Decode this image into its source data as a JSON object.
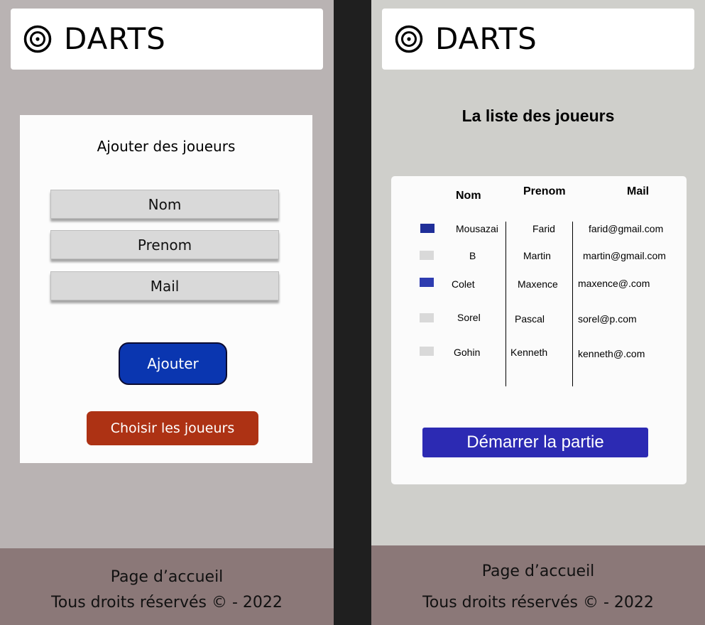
{
  "app": {
    "brand": "DARTS"
  },
  "add_screen": {
    "title": "Ajouter des joueurs",
    "fields": {
      "nom": "Nom",
      "prenom": "Prenom",
      "mail": "Mail"
    },
    "add_button": "Ajouter",
    "choose_button": "Choisir les joueurs"
  },
  "list_screen": {
    "title": "La liste des joueurs",
    "columns": {
      "nom": "Nom",
      "prenom": "Prenom",
      "mail": "Mail"
    },
    "players": [
      {
        "nom": "Mousazai",
        "prenom": "Farid",
        "mail": "farid@gmail.com",
        "color": "#1f2e99"
      },
      {
        "nom": "B",
        "prenom": "Martin",
        "mail": "martin@gmail.com",
        "color": "#d9d9d9"
      },
      {
        "nom": "Colet",
        "prenom": "Maxence",
        "mail": "maxence@.com",
        "color": "#2e3cb0"
      },
      {
        "nom": "Sorel",
        "prenom": "Pascal",
        "mail": "sorel@p.com",
        "color": "#d9d9d9"
      },
      {
        "nom": "Gohin",
        "prenom": "Kenneth",
        "mail": "kenneth@.com",
        "color": "#d9d9d9"
      }
    ],
    "start_button": "Démarrer la partie"
  },
  "footer": {
    "home": "Page d’accueil",
    "copyright": "Tous droits réservés © - 2022"
  }
}
